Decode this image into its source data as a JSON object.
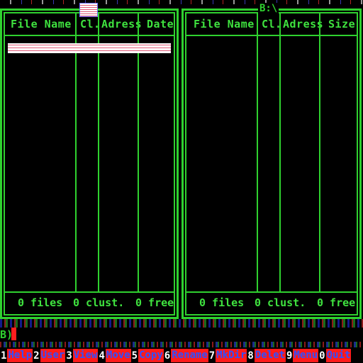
{
  "left_panel": {
    "columns": [
      "File Name",
      "Cl.",
      "Adress",
      "Date"
    ],
    "footer": {
      "files": "0 files",
      "clusters": "0 clust.",
      "free": "0 free"
    }
  },
  "right_panel": {
    "path": "B:\\",
    "columns": [
      "File Name",
      "Cl.",
      "Adress",
      "Size"
    ],
    "footer": {
      "files": "0 files",
      "clusters": "0 clust.",
      "free": "0 free"
    }
  },
  "command_line": {
    "prompt": "B)"
  },
  "function_keys": [
    {
      "num": "1",
      "label": "Help"
    },
    {
      "num": "2",
      "label": "User"
    },
    {
      "num": "3",
      "label": "View"
    },
    {
      "num": "4",
      "label": "Move"
    },
    {
      "num": "5",
      "label": "Copy"
    },
    {
      "num": "6",
      "label": "Rename"
    },
    {
      "num": "7",
      "label": "MkDir"
    },
    {
      "num": "8",
      "label": "Delet"
    },
    {
      "num": "9",
      "label": "Menu"
    },
    {
      "num": "0",
      "label": "Quit"
    }
  ],
  "colors": {
    "frame": "#2fd12f",
    "fkey_bg": "#ff1a1a",
    "fkey_text": "#3050ff",
    "caret": "#ff1e1e"
  }
}
